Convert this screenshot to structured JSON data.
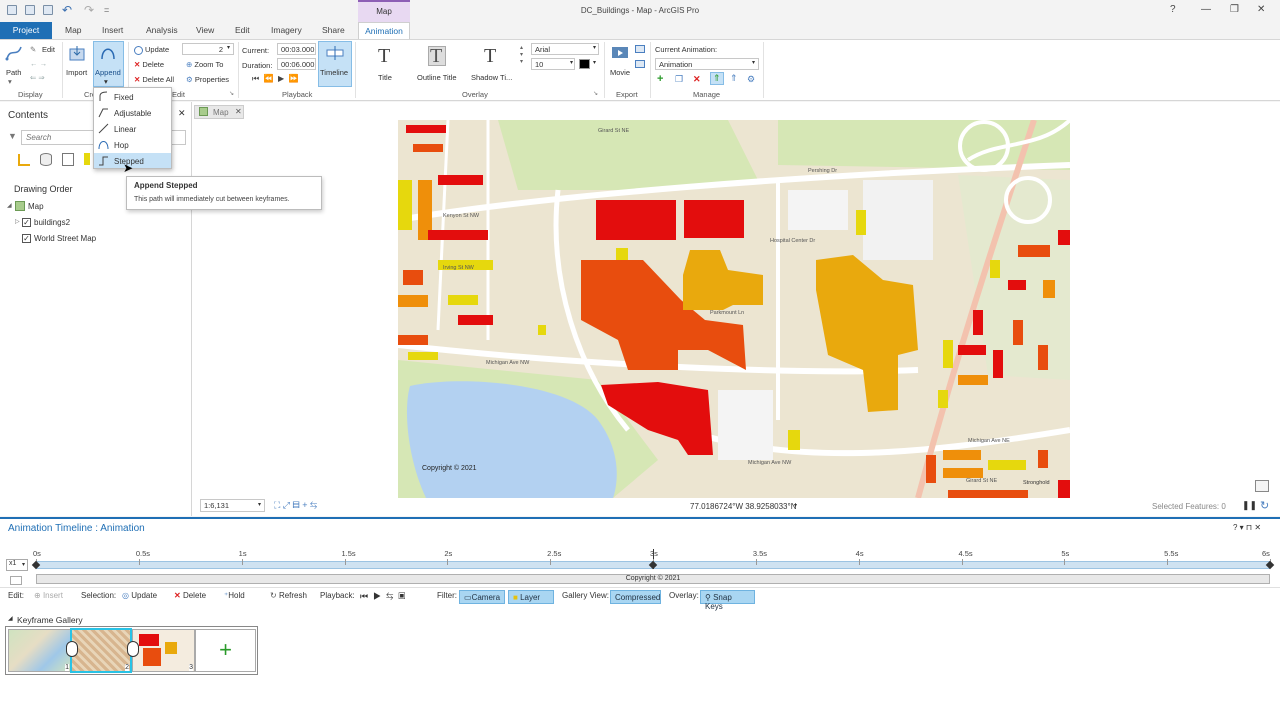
{
  "title": {
    "text": "DC_Buildings - Map - ArcGIS Pro",
    "help": "?",
    "context_group": "Map"
  },
  "tabs": [
    "Project",
    "Map",
    "Insert",
    "Analysis",
    "View",
    "Edit",
    "Imagery",
    "Share",
    "Animation"
  ],
  "ribbon": {
    "display": {
      "label": "Display",
      "path": "Path",
      "edit": "Edit"
    },
    "create": {
      "label": "Cre",
      "import": "Import",
      "append": "Append"
    },
    "edit": {
      "label": "Edit",
      "update": "Update",
      "delete": "Delete",
      "delete_all": "Delete All",
      "zoom_to": "Zoom To",
      "properties": "Properties",
      "count": "2"
    },
    "playback": {
      "label": "Playback",
      "current_label": "Current:",
      "current": "00:03.000",
      "duration_label": "Duration:",
      "duration": "00:06.000",
      "timeline": "Timeline"
    },
    "overlay": {
      "label": "Overlay",
      "title": "Title",
      "outline_title": "Outline Title",
      "shadow_title": "Shadow Ti...",
      "font": "Arial",
      "size": "10"
    },
    "export": {
      "label": "Export",
      "movie": "Movie"
    },
    "manage": {
      "label": "Manage",
      "current_animation_label": "Current Animation:",
      "current_animation": "Animation"
    }
  },
  "append_menu": {
    "items": [
      "Fixed",
      "Adjustable",
      "Linear",
      "Hop",
      "Stepped"
    ],
    "highlighted": "Stepped"
  },
  "tooltip": {
    "title": "Append Stepped",
    "text": "This path will immediately cut between keyframes."
  },
  "contents": {
    "title": "Contents",
    "search_placeholder": "Search",
    "drawing_order": "Drawing Order",
    "map_node": "Map",
    "layers": [
      "buildings2",
      "World Street Map"
    ]
  },
  "map": {
    "tab": "Map",
    "scale": "1:6,131",
    "coords": "77.0186724°W 38.9258033°N",
    "selected_features": "Selected Features: 0",
    "copyright": "Copyright © 2021",
    "streets": [
      "Irving St NW",
      "Kenyon St NW",
      "Hospital Center Dr",
      "Michigan Ave NW",
      "Parkmount Ln",
      "1st St NW",
      "N Capitol St NW",
      "Hawthorne Dr NE",
      "Michigan Ave NE",
      "Girard St NE",
      "Pershing Dr",
      "Irving St",
      "Irving St NW",
      "Park Pl NW",
      "Warder St NW",
      "Luray Pl NW",
      "Harvard St NW",
      "Columbia Rd NW",
      "Michigan Ave NW",
      "Stronghold",
      "Capitol St",
      "Sherman Cir NE"
    ],
    "colors": {
      "red": "#e30d0d",
      "orange_red": "#e84d0e",
      "orange": "#ef8f0a",
      "amber": "#e9a90d",
      "yellow": "#e6d80d",
      "water": "#b3d1f1",
      "park": "#d6e7b5",
      "road": "#ffffff"
    }
  },
  "timeline": {
    "title": "Animation Timeline : Animation",
    "speed": "x1",
    "ticks": [
      "0s",
      "0.5s",
      "1s",
      "1.5s",
      "2s",
      "2.5s",
      "3s",
      "3.5s",
      "4s",
      "4.5s",
      "5s",
      "5.5s",
      "6s"
    ],
    "current_time_fraction": 0.5,
    "overlay_track": "Copyright © 2021",
    "toolbar": {
      "edit": "Edit:",
      "insert": "Insert",
      "selection": "Selection:",
      "update": "Update",
      "delete": "Delete",
      "hold": "Hold",
      "refresh": "Refresh",
      "playback": "Playback:",
      "filter": "Filter:",
      "camera": "Camera",
      "layer": "Layer",
      "gallery_view": "Gallery View:",
      "compressed": "Compressed",
      "overlay": "Overlay:",
      "snap_keys": "Snap Keys"
    },
    "gallery": {
      "title": "Keyframe Gallery",
      "keyframes": [
        "1",
        "2",
        "3"
      ]
    }
  }
}
